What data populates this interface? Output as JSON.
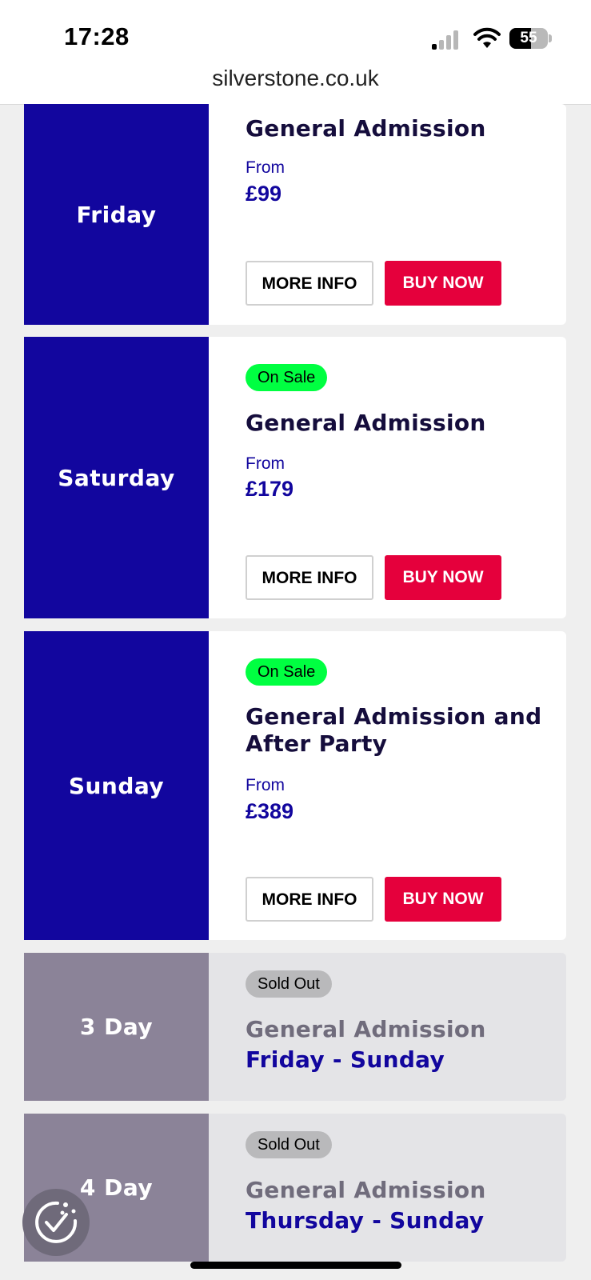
{
  "status_bar": {
    "time": "17:28",
    "battery": "55"
  },
  "browser": {
    "url": "silverstone.co.uk"
  },
  "cards": [
    {
      "day": "Friday",
      "title": "General Admission",
      "from_label": "From",
      "price": "£99",
      "more_info": "MORE INFO",
      "buy_now": "BUY NOW"
    },
    {
      "day": "Saturday",
      "badge": "On Sale",
      "title": "General Admission",
      "from_label": "From",
      "price": "£179",
      "more_info": "MORE INFO",
      "buy_now": "BUY NOW"
    },
    {
      "day": "Sunday",
      "badge": "On Sale",
      "title_line1": "General Admission and",
      "title_line2": "After Party",
      "from_label": "From",
      "price": "£389",
      "more_info": "MORE INFO",
      "buy_now": "BUY NOW"
    },
    {
      "day": "3 Day",
      "badge": "Sold Out",
      "title": "General Admission",
      "subtitle": "Friday - Sunday"
    },
    {
      "day": "4 Day",
      "badge": "Sold Out",
      "title": "General Admission",
      "subtitle": "Thursday - Sunday"
    }
  ],
  "colors": {
    "day_panel": "#12069e",
    "sold_day_panel": "#8b8398",
    "buy_button": "#e5003c",
    "on_sale_badge": "#00ff41"
  },
  "icons": {
    "cookie_settings": "cookie-check-icon"
  }
}
